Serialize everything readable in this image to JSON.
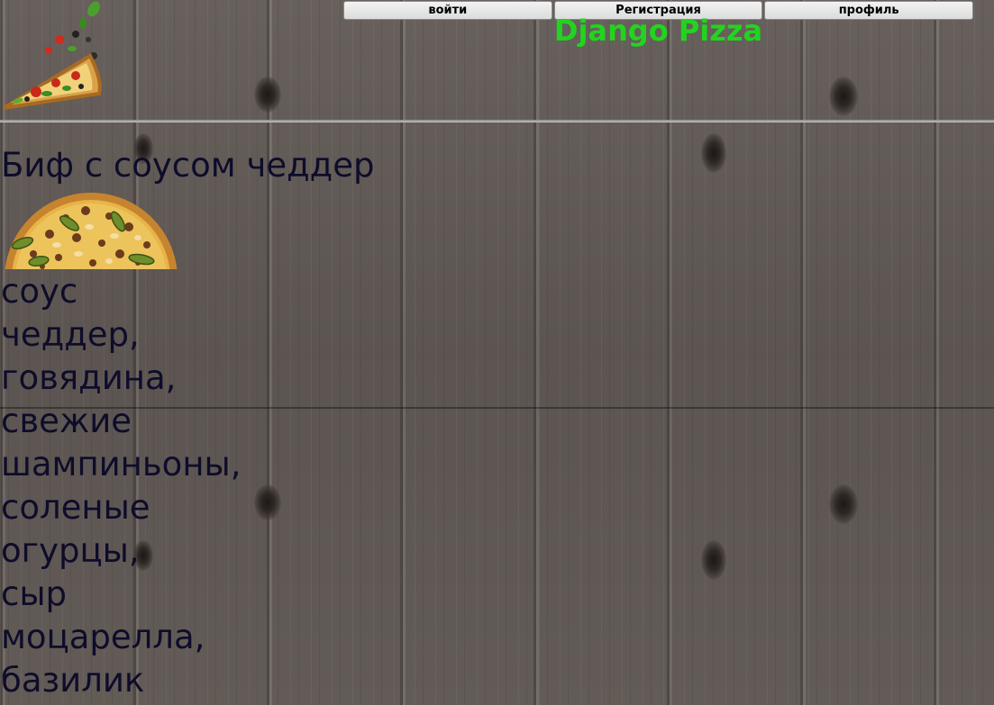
{
  "header": {
    "title": "Django Pizza",
    "title_color": "#22d41f",
    "logo_icon": "pizza-slice-logo-icon",
    "nav": [
      {
        "label": "войти"
      },
      {
        "label": "Регистрация"
      },
      {
        "label": "профиль"
      }
    ]
  },
  "product": {
    "name": "Биф с соусом чеддер",
    "image_icon": "pizza-image",
    "description_lines": [
      "соус",
      "чеддер,",
      "говядина,",
      "свежие",
      "шампиньоны,",
      "соленые",
      "огурцы,",
      "сыр",
      "моцарелла,",
      "базилик"
    ],
    "text_color": "#0e0c2a"
  }
}
